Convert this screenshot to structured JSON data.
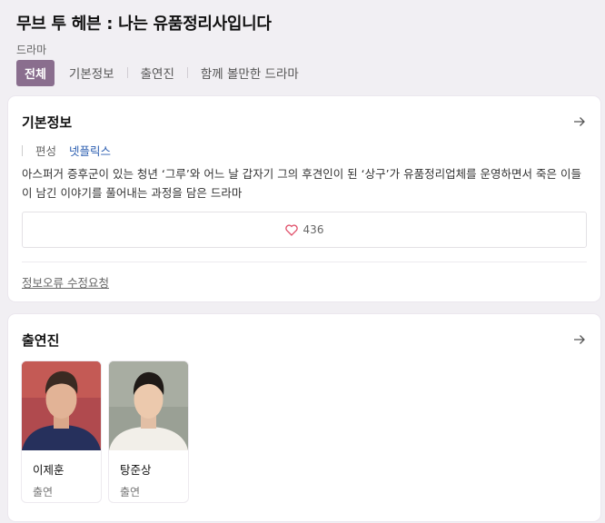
{
  "header": {
    "title": "무브 투 헤븐 : 나는 유품정리사입니다",
    "genre": "드라마"
  },
  "tabs": [
    {
      "label": "전체"
    },
    {
      "label": "기본정보"
    },
    {
      "label": "출연진"
    },
    {
      "label": "함께 볼만한 드라마"
    }
  ],
  "basic_info": {
    "title": "기본정보",
    "meta_key": "편성",
    "meta_value": "넷플릭스",
    "description": "아스퍼거 증후군이 있는 청년 ‘그루’와 어느 날 갑자기 그의 후견인이 된 ‘상구’가 유품정리업체를 운영하면서 죽은 이들이 남긴 이야기를 풀어내는 과정을 담은 드라마",
    "likes": "436",
    "report_link": "정보오류 수정요청"
  },
  "cast": {
    "title": "출연진",
    "members": [
      {
        "name": "이제훈",
        "role": "출연"
      },
      {
        "name": "탕준상",
        "role": "출연"
      }
    ]
  },
  "colors": {
    "accent": "#8a6e8e",
    "link": "#2a5db0",
    "heart": "#e0506a"
  }
}
